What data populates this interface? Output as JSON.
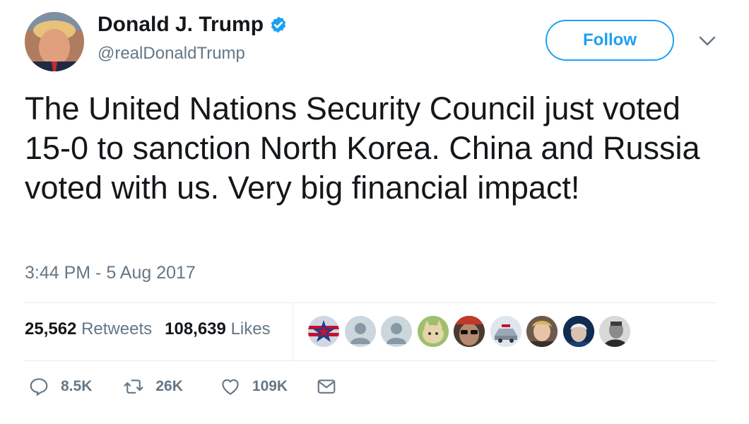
{
  "user": {
    "name": "Donald J. Trump",
    "handle": "@realDonaldTrump",
    "verified": true
  },
  "follow_label": "Follow",
  "tweet": {
    "text": "The United Nations Security Council just voted 15-0 to sanction North Korea. China and Russia voted with us. Very big financial impact!",
    "timestamp": "3:44 PM - 5 Aug 2017"
  },
  "stats": {
    "retweets_count": "25,562",
    "retweets_label": "Retweets",
    "likes_count": "108,639",
    "likes_label": "Likes"
  },
  "liker_avatars": [
    "star-flag-avatar",
    "default-avatar",
    "default-avatar",
    "cat-avatar",
    "sunglasses-avatar",
    "car-avatar",
    "portrait-avatar",
    "dark-portrait-avatar",
    "bw-portrait-avatar"
  ],
  "actions": {
    "replies": "8.5K",
    "retweets": "26K",
    "likes": "109K"
  },
  "colors": {
    "accent": "#1da1f2",
    "text": "#14171a",
    "secondary": "#657786",
    "border": "#e6ecf0"
  }
}
